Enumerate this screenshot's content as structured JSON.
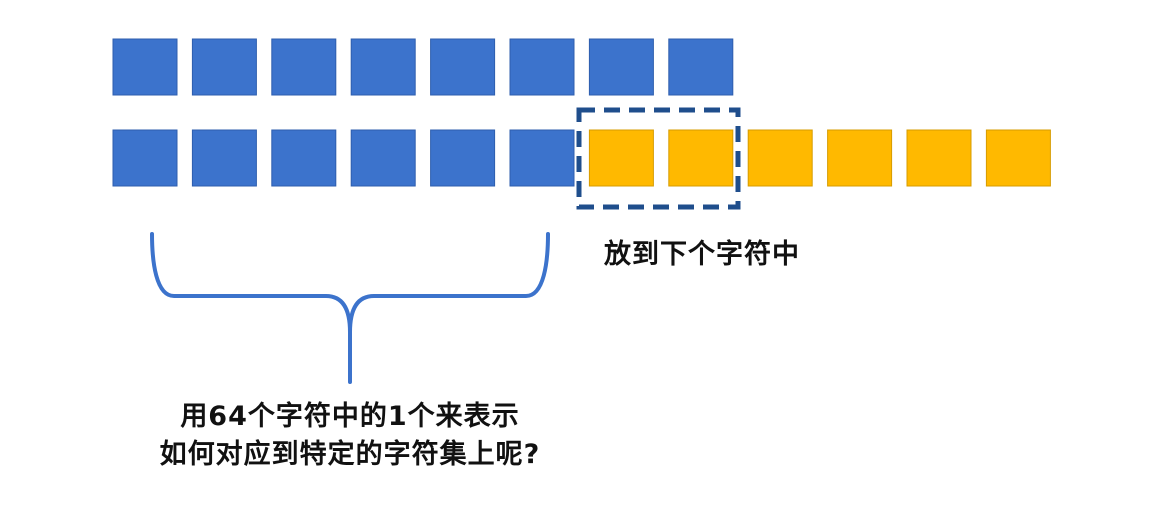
{
  "colors": {
    "blue_fill": "#3C73CC",
    "blue_stroke": "#2E5EAE",
    "yellow_fill": "#FFB900",
    "yellow_stroke": "#D79C00",
    "dash_box": "#1F4E8C",
    "brace": "#3C73CC"
  },
  "rows": {
    "top": {
      "blue": 8,
      "yellow": 0
    },
    "bottom": {
      "blue": 6,
      "yellow": 6
    }
  },
  "labels": {
    "next_char": "放到下个字符中",
    "caption_line1": "用64个字符中的1个来表示",
    "caption_line2": "如何对应到特定的字符集上呢?"
  }
}
